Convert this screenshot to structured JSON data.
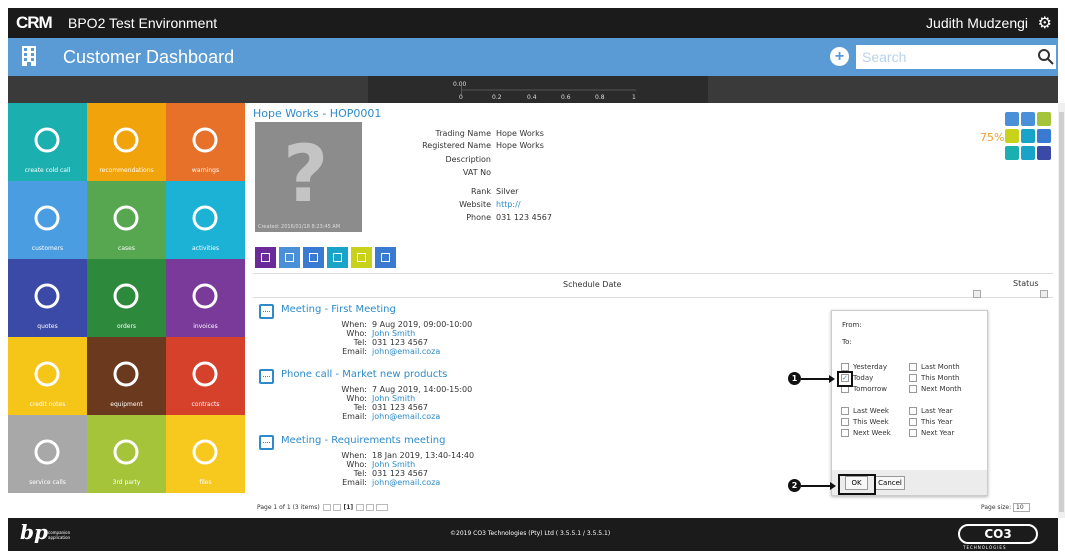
{
  "titlebar": {
    "logo": "CRM",
    "environment": "BPO2 Test Environment",
    "user": "Judith Mudzengi"
  },
  "header": {
    "title": "Customer Dashboard",
    "search_placeholder": "Search"
  },
  "mini_chart": {
    "top_value": "0.00",
    "ticks": [
      "0",
      "0.2",
      "0.4",
      "0.6",
      "0.8",
      "1"
    ]
  },
  "tiles": [
    {
      "label": "create cold call",
      "icon": "phone-icon",
      "color": "#1cafaf"
    },
    {
      "label": "recommendations",
      "icon": "lightbulb-icon",
      "color": "#f0a30a"
    },
    {
      "label": "warnings",
      "icon": "warning-icon",
      "color": "#e8712a"
    },
    {
      "label": "customers",
      "icon": "building-icon",
      "color": "#4a9de0"
    },
    {
      "label": "cases",
      "icon": "briefcase-icon",
      "color": "#56a750"
    },
    {
      "label": "activities",
      "icon": "calendar-icon",
      "color": "#1bb2d6"
    },
    {
      "label": "quotes",
      "icon": "speech-bubbles-icon",
      "color": "#3a4aa6"
    },
    {
      "label": "orders",
      "icon": "book-icon",
      "color": "#2d8a3c"
    },
    {
      "label": "invoices",
      "icon": "arrow-redo-icon",
      "color": "#7a3a9a"
    },
    {
      "label": "credit notes",
      "icon": "undo-icon",
      "color": "#f5c518"
    },
    {
      "label": "equipment",
      "icon": "gears-icon",
      "color": "#6b3a1e"
    },
    {
      "label": "contracts",
      "icon": "award-icon",
      "color": "#d6412c"
    },
    {
      "label": "service calls",
      "icon": "phone-icon",
      "color": "#a8a8a8"
    },
    {
      "label": "3rd party",
      "icon": "share-icon",
      "color": "#a6c43a"
    },
    {
      "label": "files",
      "icon": "folder-icon",
      "color": "#f7c81e"
    }
  ],
  "customer": {
    "name": "Hope Works - HOP0001",
    "created": "Created: 2016/01/18 8:23:45 AM",
    "fields": [
      {
        "label": "Trading Name",
        "value": "Hope Works"
      },
      {
        "label": "Registered Name",
        "value": "Hope Works"
      },
      {
        "label": "Description",
        "value": ""
      },
      {
        "label": "VAT No",
        "value": ""
      },
      {
        "label": "Rank",
        "value": "Silver"
      },
      {
        "label": "Website",
        "value": "http://"
      },
      {
        "label": "Phone",
        "value": "031 123 4567"
      }
    ],
    "completion": "75%"
  },
  "tabs": [
    {
      "icon": "chart-icon",
      "color": "#6a2a9a"
    },
    {
      "icon": "building-icon",
      "color": "#4a90d9"
    },
    {
      "icon": "address-book-icon",
      "color": "#3a7ad0"
    },
    {
      "icon": "calendar-icon",
      "color": "#1aa3c8"
    },
    {
      "icon": "document-icon",
      "color": "#c9d21a"
    },
    {
      "icon": "contacts-icon",
      "color": "#3a7ad0"
    }
  ],
  "schedule": {
    "column_date": "Schedule Date",
    "column_status": "Status",
    "events": [
      {
        "title": "Meeting - First Meeting",
        "when": "9 Aug 2019, 09:00-10:00",
        "who": "John Smith",
        "tel": "031 123 4567",
        "email": "john@email.coza"
      },
      {
        "title": "Phone call - Market new products",
        "when": "7 Aug 2019, 14:00-15:00",
        "who": "John Smith",
        "tel": "031 123 4567",
        "email": "john@email.coza"
      },
      {
        "title": "Meeting - Requirements meeting",
        "when": "18 Jan 2019, 13:40-14:40",
        "who": "John Smith",
        "tel": "031 123 4567",
        "email": "john@email.coza"
      }
    ],
    "labels": {
      "when": "When:",
      "who": "Who:",
      "tel": "Tel:",
      "email": "Email:"
    },
    "pager": {
      "text": "Page 1 of 1 (3 items)",
      "current": "[1]",
      "page_size_label": "Page size:",
      "page_size": "10"
    }
  },
  "date_filter": {
    "from_label": "From:",
    "to_label": "To:",
    "options_left": [
      "Yesterday",
      "Today",
      "Tomorrow",
      "Last Week",
      "This Week",
      "Next Week"
    ],
    "options_right": [
      "Last Month",
      "This Month",
      "Next Month",
      "Last Year",
      "This Year",
      "Next Year"
    ],
    "checked": "Today",
    "ok": "OK",
    "cancel": "Cancel"
  },
  "annotations": {
    "marker1": "1",
    "marker2": "2"
  },
  "footer": {
    "brand": "bp",
    "brand_sub": "companion application",
    "copyright": "©2019 CO3 Technologies (Pty) Ltd ( 3.5.5.1 / 3.5.5.1)",
    "co3": "CO3",
    "co3_sub": "TECHNOLOGIES"
  }
}
